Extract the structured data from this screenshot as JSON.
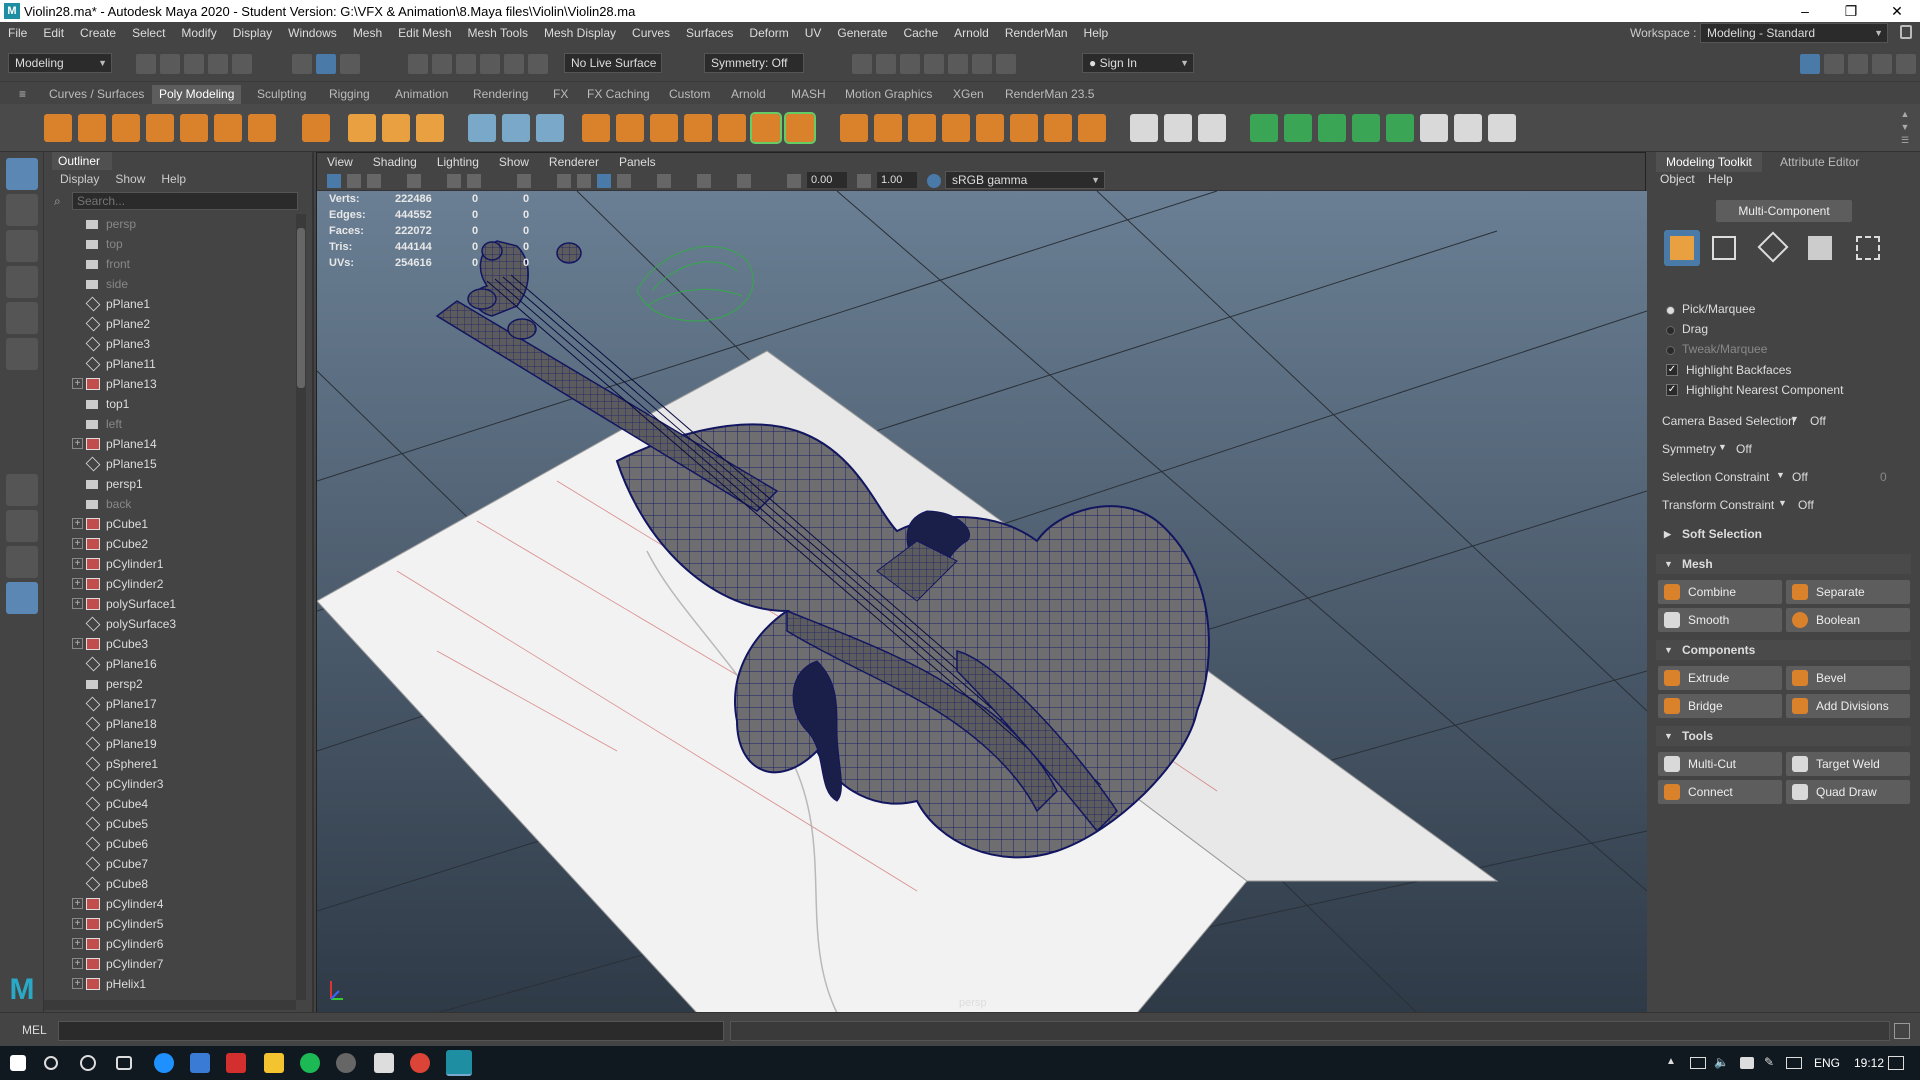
{
  "window": {
    "title": "Violin28.ma* - Autodesk Maya 2020 - Student Version: G:\\VFX & Animation\\8.Maya files\\Violin\\Violin28.ma",
    "app_icon": "M",
    "minimize": "–",
    "maximize": "❐",
    "close": "✕"
  },
  "menubar": {
    "items": [
      "File",
      "Edit",
      "Create",
      "Select",
      "Modify",
      "Display",
      "Windows",
      "Mesh",
      "Edit Mesh",
      "Mesh Tools",
      "Mesh Display",
      "Curves",
      "Surfaces",
      "Deform",
      "UV",
      "Generate",
      "Cache",
      "Arnold",
      "RenderMan",
      "Help"
    ],
    "workspace_label": "Workspace :",
    "workspace_value": "Modeling - Standard"
  },
  "statusline": {
    "mode": "Modeling",
    "live_surface": "No Live Surface",
    "symmetry": "Symmetry: Off",
    "sign_in": "Sign In"
  },
  "shelf_tabs": [
    "Curves / Surfaces",
    "Poly Modeling",
    "Sculpting",
    "Rigging",
    "Animation",
    "Rendering",
    "FX",
    "FX Caching",
    "Custom",
    "Arnold",
    "MASH",
    "Motion Graphics",
    "XGen",
    "RenderMan 23.5"
  ],
  "shelf_active": "Poly Modeling",
  "outliner": {
    "title": "Outliner",
    "menu": [
      "Display",
      "Show",
      "Help"
    ],
    "search_placeholder": "Search...",
    "items": [
      {
        "name": "persp",
        "type": "camera",
        "dim": true,
        "exp": false
      },
      {
        "name": "top",
        "type": "camera",
        "dim": true,
        "exp": false
      },
      {
        "name": "front",
        "type": "camera",
        "dim": true,
        "exp": false
      },
      {
        "name": "side",
        "type": "camera",
        "dim": true,
        "exp": false
      },
      {
        "name": "pPlane1",
        "type": "mesh",
        "dim": false,
        "exp": false
      },
      {
        "name": "pPlane2",
        "type": "mesh",
        "dim": false,
        "exp": false
      },
      {
        "name": "pPlane3",
        "type": "mesh",
        "dim": false,
        "exp": false
      },
      {
        "name": "pPlane11",
        "type": "mesh",
        "dim": false,
        "exp": false
      },
      {
        "name": "pPlane13",
        "type": "group",
        "dim": false,
        "exp": true
      },
      {
        "name": "top1",
        "type": "camera",
        "dim": false,
        "exp": false
      },
      {
        "name": "left",
        "type": "camera",
        "dim": true,
        "exp": false
      },
      {
        "name": "pPlane14",
        "type": "group",
        "dim": false,
        "exp": true
      },
      {
        "name": "pPlane15",
        "type": "mesh",
        "dim": false,
        "exp": false
      },
      {
        "name": "persp1",
        "type": "camera",
        "dim": false,
        "exp": false
      },
      {
        "name": "back",
        "type": "camera",
        "dim": true,
        "exp": false
      },
      {
        "name": "pCube1",
        "type": "group",
        "dim": false,
        "exp": true
      },
      {
        "name": "pCube2",
        "type": "group",
        "dim": false,
        "exp": true
      },
      {
        "name": "pCylinder1",
        "type": "group",
        "dim": false,
        "exp": true
      },
      {
        "name": "pCylinder2",
        "type": "group",
        "dim": false,
        "exp": true
      },
      {
        "name": "polySurface1",
        "type": "group",
        "dim": false,
        "exp": true
      },
      {
        "name": "polySurface3",
        "type": "mesh",
        "dim": false,
        "exp": false
      },
      {
        "name": "pCube3",
        "type": "group",
        "dim": false,
        "exp": true
      },
      {
        "name": "pPlane16",
        "type": "mesh",
        "dim": false,
        "exp": false
      },
      {
        "name": "persp2",
        "type": "camera",
        "dim": false,
        "exp": false
      },
      {
        "name": "pPlane17",
        "type": "mesh",
        "dim": false,
        "exp": false
      },
      {
        "name": "pPlane18",
        "type": "mesh",
        "dim": false,
        "exp": false
      },
      {
        "name": "pPlane19",
        "type": "mesh",
        "dim": false,
        "exp": false
      },
      {
        "name": "pSphere1",
        "type": "mesh",
        "dim": false,
        "exp": false
      },
      {
        "name": "pCylinder3",
        "type": "mesh",
        "dim": false,
        "exp": false
      },
      {
        "name": "pCube4",
        "type": "mesh",
        "dim": false,
        "exp": false
      },
      {
        "name": "pCube5",
        "type": "mesh",
        "dim": false,
        "exp": false
      },
      {
        "name": "pCube6",
        "type": "mesh",
        "dim": false,
        "exp": false
      },
      {
        "name": "pCube7",
        "type": "mesh",
        "dim": false,
        "exp": false
      },
      {
        "name": "pCube8",
        "type": "mesh",
        "dim": false,
        "exp": false
      },
      {
        "name": "pCylinder4",
        "type": "group",
        "dim": false,
        "exp": true
      },
      {
        "name": "pCylinder5",
        "type": "group",
        "dim": false,
        "exp": true
      },
      {
        "name": "pCylinder6",
        "type": "group",
        "dim": false,
        "exp": true
      },
      {
        "name": "pCylinder7",
        "type": "group",
        "dim": false,
        "exp": true
      },
      {
        "name": "pHelix1",
        "type": "group",
        "dim": false,
        "exp": true
      }
    ]
  },
  "viewport": {
    "menu": [
      "View",
      "Shading",
      "Lighting",
      "Show",
      "Renderer",
      "Panels"
    ],
    "field_a": "0.00",
    "field_b": "1.00",
    "color_space": "sRGB gamma",
    "camera_label": "persp",
    "hud": [
      {
        "label": "Verts:",
        "v1": "222486",
        "v2": "0",
        "v3": "0"
      },
      {
        "label": "Edges:",
        "v1": "444552",
        "v2": "0",
        "v3": "0"
      },
      {
        "label": "Faces:",
        "v1": "222072",
        "v2": "0",
        "v3": "0"
      },
      {
        "label": "Tris:",
        "v1": "444144",
        "v2": "0",
        "v3": "0"
      },
      {
        "label": "UVs:",
        "v1": "254616",
        "v2": "0",
        "v3": "0"
      }
    ]
  },
  "toolkit": {
    "tabs": [
      "Modeling Toolkit",
      "Attribute Editor"
    ],
    "menu": [
      "Object",
      "Help"
    ],
    "multi_component": "Multi-Component",
    "pick_marquee": "Pick/Marquee",
    "drag": "Drag",
    "tweak_marquee": "Tweak/Marquee",
    "highlight_backfaces": "Highlight Backfaces",
    "highlight_nearest": "Highlight Nearest Component",
    "camera_based_selection": "Camera Based Selection",
    "camera_based_value": "Off",
    "symmetry": "Symmetry",
    "symmetry_value": "Off",
    "selection_constraint": "Selection Constraint",
    "selection_constraint_value": "Off",
    "selection_constraint_num": "0",
    "transform_constraint": "Transform Constraint",
    "transform_constraint_value": "Off",
    "soft_selection": "Soft Selection",
    "mesh_section": "Mesh",
    "combine": "Combine",
    "separate": "Separate",
    "smooth": "Smooth",
    "boolean": "Boolean",
    "components_section": "Components",
    "extrude": "Extrude",
    "bevel": "Bevel",
    "bridge": "Bridge",
    "add_divisions": "Add Divisions",
    "tools_section": "Tools",
    "multi_cut": "Multi-Cut",
    "target_weld": "Target Weld",
    "connect": "Connect",
    "quad_draw": "Quad Draw"
  },
  "cmdline": {
    "lang": "MEL"
  },
  "taskbar": {
    "lang": "ENG",
    "time": "19:12"
  }
}
